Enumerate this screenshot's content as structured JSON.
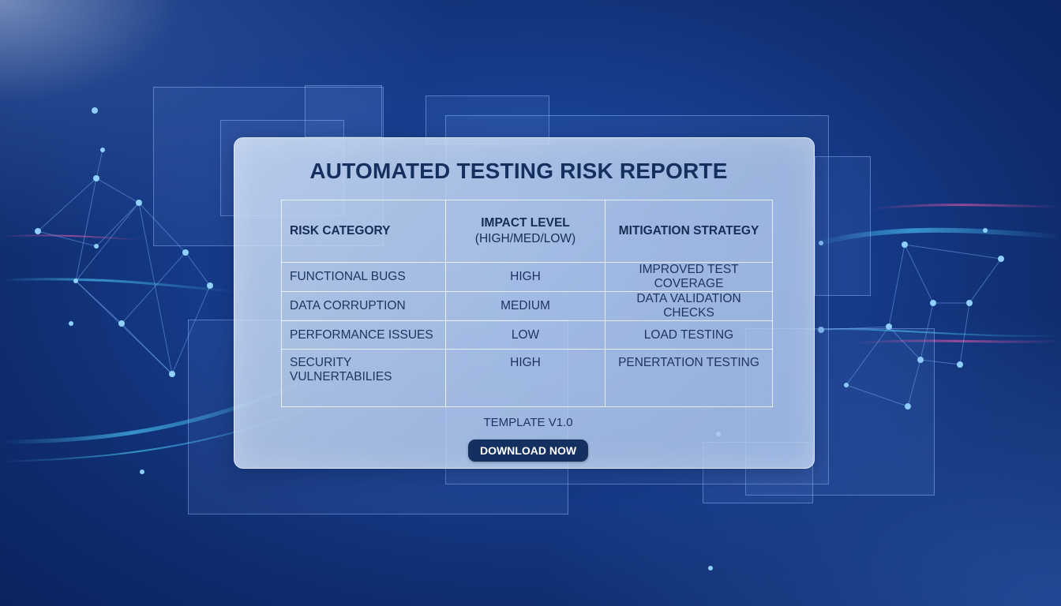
{
  "report": {
    "title": "AUTOMATED TESTING RISK REPORTE",
    "table": {
      "headers": {
        "category": "RISK CATEGORY",
        "impact_line1": "IMPACT LEVEL",
        "impact_line2": "(HIGH/MED/LOW)",
        "mitigation": "MITIGATION STRATEGY"
      },
      "rows": [
        {
          "category": "FUNCTIONAL BUGS",
          "impact": "HIGH",
          "mitigation": "IMPROVED TEST COVERAGE"
        },
        {
          "category": "DATA CORRUPTION",
          "impact": "MEDIUM",
          "mitigation": "DATA VALIDATION CHECKS"
        },
        {
          "category": "PERFORMANCE ISSUES",
          "impact": "LOW",
          "mitigation": "LOAD TESTING"
        },
        {
          "category_line1": "SECURITY",
          "category_line2": "VULNERTABILIES",
          "impact": "HIGH",
          "mitigation": "PENERTATION TESTING"
        }
      ]
    },
    "version": "TEMPLATE V1.0",
    "download_label": "DOWNLOAD NOW"
  },
  "colors": {
    "accent": "#143061",
    "title_text": "#15305e",
    "background": "#173f8f"
  }
}
